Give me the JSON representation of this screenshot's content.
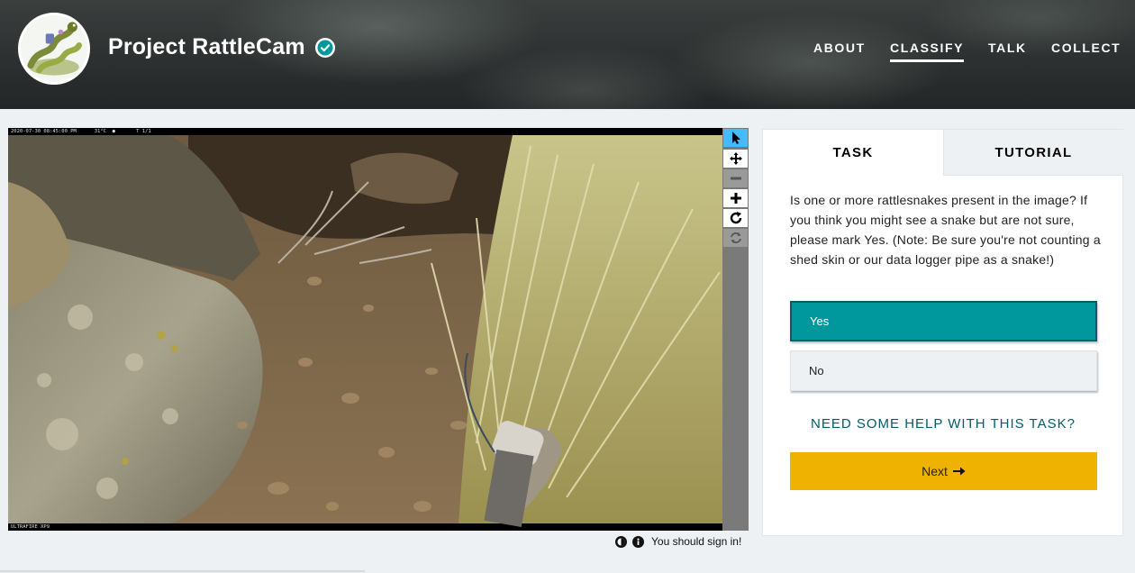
{
  "header": {
    "project_title": "Project RattleCam",
    "nav": [
      {
        "label": "About",
        "active": false
      },
      {
        "label": "Classify",
        "active": true
      },
      {
        "label": "Talk",
        "active": false
      },
      {
        "label": "Collect",
        "active": false
      }
    ]
  },
  "subject": {
    "camera_stamp": "2020-07-30 08:45:00 PM      31°C  ●       T 1/1",
    "camera_brand": "ULTRAFIRE XP9",
    "toolbar": [
      {
        "icon": "pointer-icon",
        "active": true,
        "disabled": false
      },
      {
        "icon": "move-icon",
        "active": false,
        "disabled": false
      },
      {
        "icon": "zoom-out-icon",
        "active": false,
        "disabled": true
      },
      {
        "icon": "zoom-in-icon",
        "active": false,
        "disabled": false
      },
      {
        "icon": "rotate-icon",
        "active": false,
        "disabled": false
      },
      {
        "icon": "reset-icon",
        "active": false,
        "disabled": true
      }
    ]
  },
  "footer": {
    "signin_text": "You should sign in!"
  },
  "panel": {
    "tabs": {
      "task": "TASK",
      "tutorial": "TUTORIAL"
    },
    "question": "Is one or more rattlesnakes present in the image? If you think you might see a snake but are not sure, please mark Yes. (Note: Be sure you're not counting a shed skin or our data logger pipe as a snake!)",
    "answers": [
      {
        "label": "Yes",
        "selected": true
      },
      {
        "label": "No",
        "selected": false
      }
    ],
    "help_link": "NEED SOME HELP WITH THIS TASK?",
    "next_label": "Next"
  },
  "colors": {
    "selected_answer": "#00979d",
    "next_button": "#f0b200",
    "help_link": "#005d69",
    "active_tool": "#43bbfd"
  }
}
